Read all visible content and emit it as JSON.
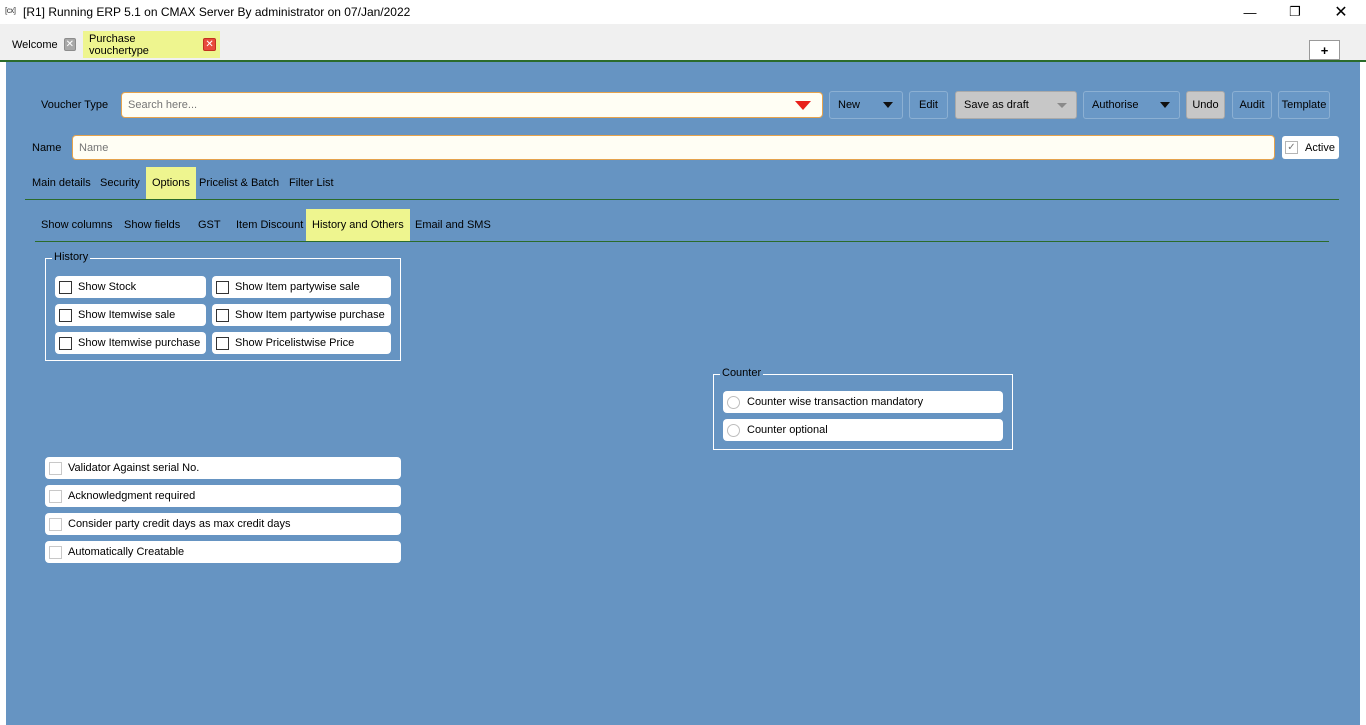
{
  "window": {
    "icon": "[cx]",
    "title": "[R1] Running ERP 5.1 on CMAX Server By administrator on 07/Jan/2022",
    "minimize_glyph": "—",
    "maximize_glyph": "❐",
    "close_glyph": "✕"
  },
  "doc_tabs": [
    {
      "label": "Welcome",
      "active": false
    },
    {
      "label": "Purchase vouchertype",
      "active": true
    }
  ],
  "plus_label": "+",
  "voucher_type": {
    "label": "Voucher Type",
    "placeholder": "Search here..."
  },
  "toolbar": {
    "new": "New",
    "edit": "Edit",
    "save_draft": "Save as draft",
    "authorise": "Authorise",
    "undo": "Undo",
    "audit": "Audit",
    "template": "Template"
  },
  "name_field": {
    "label": "Name",
    "placeholder": "Name"
  },
  "active": {
    "label": "Active",
    "checked": true
  },
  "main_tabs": [
    "Main details",
    "Security",
    "Options",
    "Pricelist & Batch",
    "Filter List"
  ],
  "main_tab_selected": "Options",
  "sub_tabs": [
    "Show columns",
    "Show fields",
    "GST",
    "Item Discount",
    "History and Others",
    "Email and SMS"
  ],
  "sub_tab_selected": "History and Others",
  "history": {
    "title": "History",
    "items": [
      "Show Stock",
      "Show Item partywise sale",
      "Show Itemwise sale",
      "Show Item partywise purchase",
      "Show Itemwise purchase",
      "Show Pricelistwise Price"
    ]
  },
  "counter": {
    "title": "Counter",
    "options": [
      "Counter wise transaction mandatory",
      "Counter optional"
    ]
  },
  "other_options": [
    "Validator Against serial No.",
    "Acknowledgment required",
    "Consider party credit days as max credit days",
    "Automatically Creatable"
  ],
  "colors": {
    "panel": "#6694c2",
    "highlight": "#eef58f",
    "accent_border": "#e5a34d",
    "dropdown_arrow": "#e8211b"
  }
}
